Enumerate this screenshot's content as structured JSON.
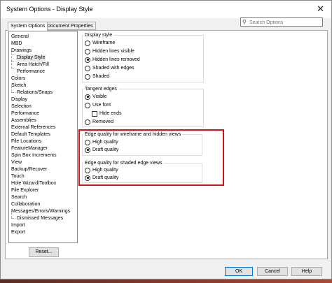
{
  "window": {
    "title": "System Options - Display Style",
    "close_glyph": "✕"
  },
  "tabs": [
    {
      "label": "System Options",
      "active": true
    },
    {
      "label": "Document Properties",
      "active": false
    }
  ],
  "search": {
    "placeholder": "Search Options",
    "icon": "search-icon"
  },
  "tree": {
    "items": [
      {
        "label": "General",
        "indent": 0
      },
      {
        "label": "MBD",
        "indent": 0
      },
      {
        "label": "Drawings",
        "indent": 0
      },
      {
        "label": "Display Style",
        "indent": 1,
        "selected": true
      },
      {
        "label": "Area Hatch/Fill",
        "indent": 1
      },
      {
        "label": "Performance",
        "indent": 1
      },
      {
        "label": "Colors",
        "indent": 0
      },
      {
        "label": "Sketch",
        "indent": 0
      },
      {
        "label": "Relations/Snaps",
        "indent": 1
      },
      {
        "label": "Display",
        "indent": 0
      },
      {
        "label": "Selection",
        "indent": 0
      },
      {
        "label": "Performance",
        "indent": 0
      },
      {
        "label": "Assemblies",
        "indent": 0
      },
      {
        "label": "External References",
        "indent": 0
      },
      {
        "label": "Default Templates",
        "indent": 0
      },
      {
        "label": "File Locations",
        "indent": 0
      },
      {
        "label": "FeatureManager",
        "indent": 0
      },
      {
        "label": "Spin Box Increments",
        "indent": 0
      },
      {
        "label": "View",
        "indent": 0
      },
      {
        "label": "Backup/Recover",
        "indent": 0
      },
      {
        "label": "Touch",
        "indent": 0
      },
      {
        "label": "Hole Wizard/Toolbox",
        "indent": 0
      },
      {
        "label": "File Explorer",
        "indent": 0
      },
      {
        "label": "Search",
        "indent": 0
      },
      {
        "label": "Collaboration",
        "indent": 0
      },
      {
        "label": "Messages/Errors/Warnings",
        "indent": 0
      },
      {
        "label": "Dismissed Messages",
        "indent": 1
      },
      {
        "label": "Import",
        "indent": 0
      },
      {
        "label": "Export",
        "indent": 0
      }
    ],
    "reset_label": "Reset..."
  },
  "display_style": {
    "title": "Display style",
    "options": [
      {
        "label": "Wireframe",
        "checked": false
      },
      {
        "label": "Hidden lines visible",
        "checked": false
      },
      {
        "label": "Hidden lines removed",
        "checked": true
      },
      {
        "label": "Shaded with edges",
        "checked": false
      },
      {
        "label": "Shaded",
        "checked": false
      }
    ]
  },
  "tangent_edges": {
    "title": "Tangent edges",
    "visible": "Visible",
    "use_font": "Use font",
    "hide_ends": "Hide ends",
    "removed": "Removed"
  },
  "edge_wireframe": {
    "title": "Edge quality for wireframe and hidden views",
    "high": "High quality",
    "draft": "Draft quality"
  },
  "edge_shaded": {
    "title": "Edge quality for shaded edge views",
    "high": "High quality",
    "draft": "Draft quality"
  },
  "buttons": {
    "ok": "OK",
    "cancel": "Cancel",
    "help": "Help"
  },
  "highlight_color": "#d0121a"
}
